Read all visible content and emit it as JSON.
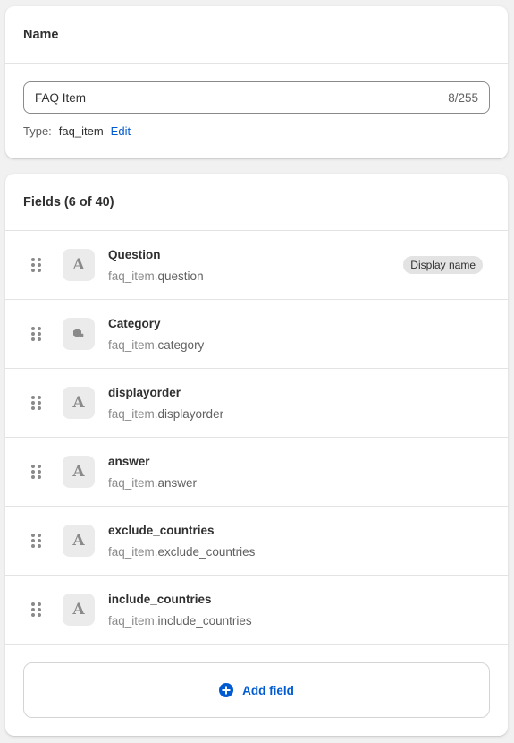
{
  "name_card": {
    "title": "Name",
    "name_value": "FAQ Item",
    "char_count": "8/255",
    "type_label": "Type:",
    "type_value": "faq_item",
    "edit_label": "Edit"
  },
  "fields_card": {
    "title": "Fields (6 of 40)",
    "fields": [
      {
        "title": "Question",
        "key_prefix": "faq_item.",
        "key_suffix": "question",
        "icon": "text-icon",
        "badge": "Display name"
      },
      {
        "title": "Category",
        "key_prefix": "faq_item.",
        "key_suffix": "category",
        "icon": "metaobject-reference-icon"
      },
      {
        "title": "displayorder",
        "key_prefix": "faq_item.",
        "key_suffix": "displayorder",
        "icon": "text-icon"
      },
      {
        "title": "answer",
        "key_prefix": "faq_item.",
        "key_suffix": "answer",
        "icon": "text-icon"
      },
      {
        "title": "exclude_countries",
        "key_prefix": "faq_item.",
        "key_suffix": "exclude_countries",
        "icon": "text-icon"
      },
      {
        "title": "include_countries",
        "key_prefix": "faq_item.",
        "key_suffix": "include_countries",
        "icon": "text-icon"
      }
    ],
    "add_field_label": "Add field",
    "text_icon_glyph": "A"
  },
  "colors": {
    "accent": "#005bd3",
    "badge_bg": "#e3e3e3",
    "icon_bg": "#ebebeb"
  }
}
